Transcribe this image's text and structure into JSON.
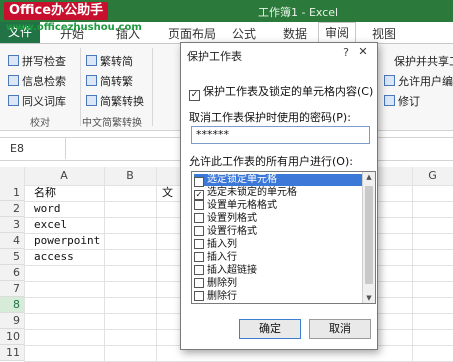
{
  "app": {
    "title": "工作簿1 - Excel",
    "watermark_top": "Office办公助手",
    "watermark_url": "www.officezhushou.com"
  },
  "tabs": {
    "file": "文件",
    "home": "开始",
    "insert": "插入",
    "page_layout": "页面布局",
    "formulas": "公式",
    "data": "数据",
    "review": "审阅",
    "view": "视图"
  },
  "ribbon": {
    "spelling": "拼写检查",
    "research": "信息检索",
    "thesaurus": "同义词库",
    "proofing_group": "校对",
    "to_traditional": "繁转简",
    "to_simplified": "简转繁",
    "convert": "简繁转换",
    "chinese_group": "中文简繁转换",
    "protect_share": "保护并共享工",
    "allow_edit": "允许用户编辑",
    "track_changes": "修订"
  },
  "formula_bar": {
    "name_box": "E8"
  },
  "grid": {
    "columns": [
      "A",
      "B",
      "G"
    ],
    "rows": [
      "1",
      "2",
      "3",
      "4",
      "5",
      "6",
      "7",
      "8",
      "9",
      "10",
      "11"
    ],
    "cells": [
      "名称",
      "word",
      "excel",
      "powerpoint",
      "access"
    ],
    "b1_fragment": "文"
  },
  "dialog": {
    "title": "保护工作表",
    "help": "?",
    "close": "✕",
    "protect_option": "保护工作表及锁定的单元格内容(C)",
    "password_label": "取消工作表保护时使用的密码(P):",
    "password_value": "******",
    "allow_label": "允许此工作表的所有用户进行(O):",
    "permissions": [
      {
        "label": "选定锁定单元格",
        "checked": true
      },
      {
        "label": "选定未锁定的单元格",
        "checked": true
      },
      {
        "label": "设置单元格格式",
        "checked": false
      },
      {
        "label": "设置列格式",
        "checked": false
      },
      {
        "label": "设置行格式",
        "checked": false
      },
      {
        "label": "插入列",
        "checked": false
      },
      {
        "label": "插入行",
        "checked": false
      },
      {
        "label": "插入超链接",
        "checked": false
      },
      {
        "label": "删除列",
        "checked": false
      },
      {
        "label": "删除行",
        "checked": false
      }
    ],
    "ok": "确定",
    "cancel": "取消"
  }
}
